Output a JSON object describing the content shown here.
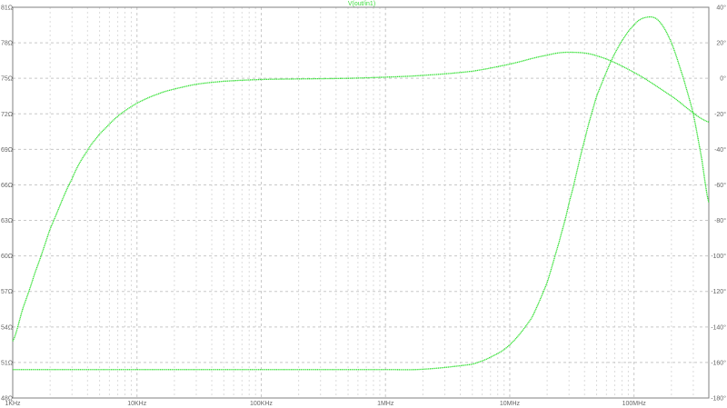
{
  "window": {
    "trace_title": "V(out/in1)"
  },
  "colors": {
    "trace": "#33e033",
    "grid_major": "#c8c8c8",
    "grid_minor": "#dcdcdc",
    "axis": "#808080",
    "label": "#666666",
    "background": "#ffffff"
  },
  "chart_data": {
    "type": "line",
    "title": "V(out/in1)",
    "x_scale": "log",
    "xlim": [
      1000,
      400000000
    ],
    "x_ticks": [
      {
        "value": 1000,
        "label": "1KHz"
      },
      {
        "value": 10000,
        "label": "10KHz"
      },
      {
        "value": 100000,
        "label": "100KHz"
      },
      {
        "value": 1000000,
        "label": "1MHz"
      },
      {
        "value": 10000000,
        "label": "10MHz"
      },
      {
        "value": 100000000,
        "label": "100MHz"
      }
    ],
    "y_left": {
      "ylim": [
        48,
        81
      ],
      "ticks": [
        {
          "value": 81,
          "label": "81Ω"
        },
        {
          "value": 78,
          "label": "78Ω"
        },
        {
          "value": 75,
          "label": "75Ω"
        },
        {
          "value": 72,
          "label": "72Ω"
        },
        {
          "value": 69,
          "label": "69Ω"
        },
        {
          "value": 66,
          "label": "66Ω"
        },
        {
          "value": 63,
          "label": "63Ω"
        },
        {
          "value": 60,
          "label": "60Ω"
        },
        {
          "value": 57,
          "label": "57Ω"
        },
        {
          "value": 54,
          "label": "54Ω"
        },
        {
          "value": 51,
          "label": "51Ω"
        },
        {
          "value": 48,
          "label": "48Ω"
        }
      ]
    },
    "y_right": {
      "ylim": [
        -180,
        40
      ],
      "ticks": [
        {
          "value": 40,
          "label": "40°"
        },
        {
          "value": 20,
          "label": "20°"
        },
        {
          "value": 0,
          "label": "0°"
        },
        {
          "value": -20,
          "label": "-20°"
        },
        {
          "value": -40,
          "label": "-40°"
        },
        {
          "value": -60,
          "label": "-60°"
        },
        {
          "value": -80,
          "label": "-80°"
        },
        {
          "value": -100,
          "label": "-100°"
        },
        {
          "value": -120,
          "label": "-120°"
        },
        {
          "value": -140,
          "label": "-140°"
        },
        {
          "value": -160,
          "label": "-160°"
        },
        {
          "value": -180,
          "label": "-180°"
        }
      ]
    },
    "grid": true,
    "series": [
      {
        "axis": "left",
        "x": [
          1000,
          1200,
          1500,
          2000,
          3000,
          4000,
          5000,
          7000,
          10000,
          15000,
          20000,
          30000,
          50000,
          100000,
          200000,
          500000,
          1000000,
          2000000,
          5000000,
          10000000,
          20000000,
          30000000,
          50000000,
          100000000,
          200000000,
          400000000
        ],
        "y": [
          52.8,
          55.5,
          58.5,
          62.3,
          66.5,
          68.9,
          70.3,
          71.8,
          72.9,
          73.7,
          74.1,
          74.5,
          74.75,
          74.9,
          74.95,
          75.0,
          75.1,
          75.25,
          75.6,
          76.2,
          76.95,
          77.2,
          76.9,
          75.5,
          73.5,
          71.3
        ]
      },
      {
        "axis": "right",
        "x": [
          1000,
          10000,
          100000,
          1000000,
          2000000,
          5000000,
          7000000,
          10000000,
          15000000,
          20000000,
          25000000,
          30000000,
          40000000,
          50000000,
          70000000,
          100000000,
          130000000,
          160000000,
          200000000,
          250000000,
          300000000,
          350000000,
          400000000
        ],
        "y": [
          -164,
          -164,
          -164,
          -164,
          -163.8,
          -161,
          -157,
          -150,
          -135,
          -115,
          -92,
          -70,
          -35,
          -10,
          14,
          30,
          34.5,
          32,
          20,
          0,
          -20,
          -45,
          -70
        ]
      }
    ]
  }
}
